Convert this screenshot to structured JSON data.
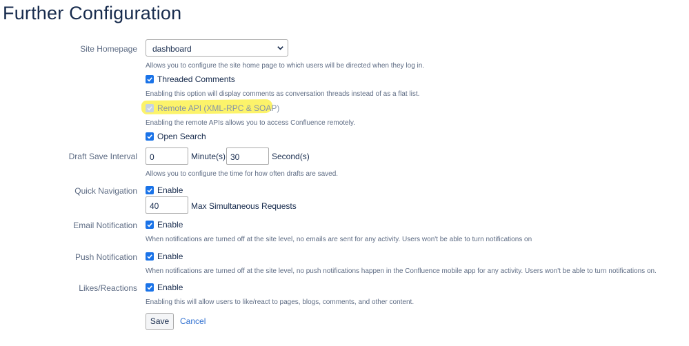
{
  "page": {
    "title": "Further Configuration"
  },
  "site_homepage": {
    "label": "Site Homepage",
    "selected": "dashboard",
    "description": "Allows you to configure the site home page to which users will be directed when they log in."
  },
  "threaded_comments": {
    "label": "Threaded Comments",
    "checked": true,
    "description": "Enabling this option will display comments as conversation threads instead of as a flat list."
  },
  "remote_api": {
    "label": "Remote API (XML-RPC & SOAP)",
    "checked": true,
    "disabled": true,
    "highlighted": true,
    "description": "Enabling the remote APIs allows you to access Confluence remotely."
  },
  "open_search": {
    "label": "Open Search",
    "checked": true
  },
  "draft_save": {
    "label": "Draft Save Interval",
    "minutes_value": "0",
    "minutes_unit": "Minute(s)",
    "seconds_value": "30",
    "seconds_unit": "Second(s)",
    "description": "Allows you to configure the time for how often drafts are saved."
  },
  "quick_navigation": {
    "label": "Quick Navigation",
    "enable_label": "Enable",
    "checked": true,
    "max_requests_value": "40",
    "max_requests_label": "Max Simultaneous Requests"
  },
  "email_notification": {
    "label": "Email Notification",
    "enable_label": "Enable",
    "checked": true,
    "description": "When notifications are turned off at the site level, no emails are sent for any activity. Users won't be able to turn notifications on"
  },
  "push_notification": {
    "label": "Push Notification",
    "enable_label": "Enable",
    "checked": true,
    "description": "When notifications are turned off at the site level, no push notifications happen in the Confluence mobile app for any activity. Users won't be able to turn notifications on."
  },
  "likes_reactions": {
    "label": "Likes/Reactions",
    "enable_label": "Enable",
    "checked": true,
    "description": "Enabling this will allow users to like/react to pages, blogs, comments, and other content."
  },
  "actions": {
    "save_label": "Save",
    "cancel_label": "Cancel"
  },
  "colors": {
    "checkbox": "#1a73e8",
    "highlight": "#fcf36a",
    "link": "#2f6fd0",
    "label_text": "#5e6c84"
  },
  "icons": {
    "select_arrow": "chevron-down-icon",
    "checkbox_mark": "checkmark-icon"
  }
}
